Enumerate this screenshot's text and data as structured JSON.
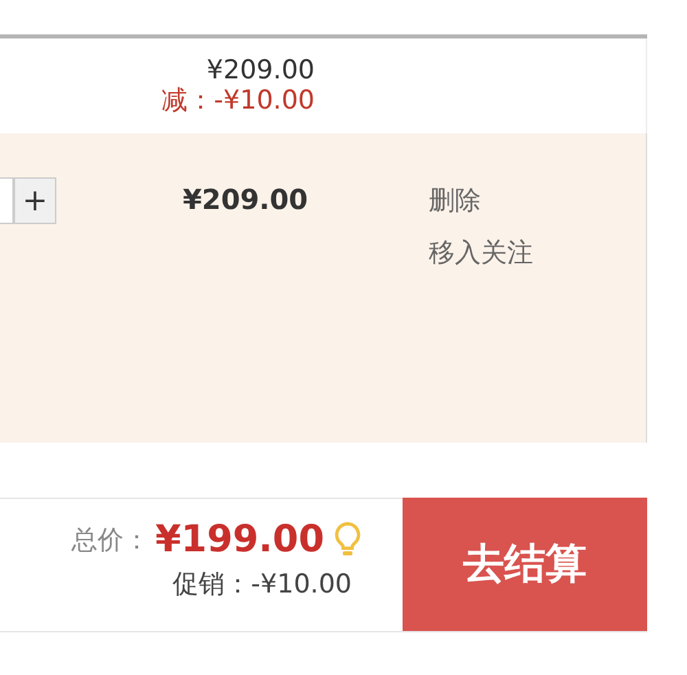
{
  "cart_item_top": {
    "price": "¥209.00",
    "discount": "减：-¥10.00"
  },
  "cart_item": {
    "quantity_button": "+",
    "subtotal": "¥209.00",
    "actions": [
      "删除",
      "移入关注"
    ]
  },
  "summary": {
    "total_label": "总价：",
    "total": "¥199.00",
    "promotion": "促销：-¥10.00",
    "checkout_button": "去结算"
  }
}
